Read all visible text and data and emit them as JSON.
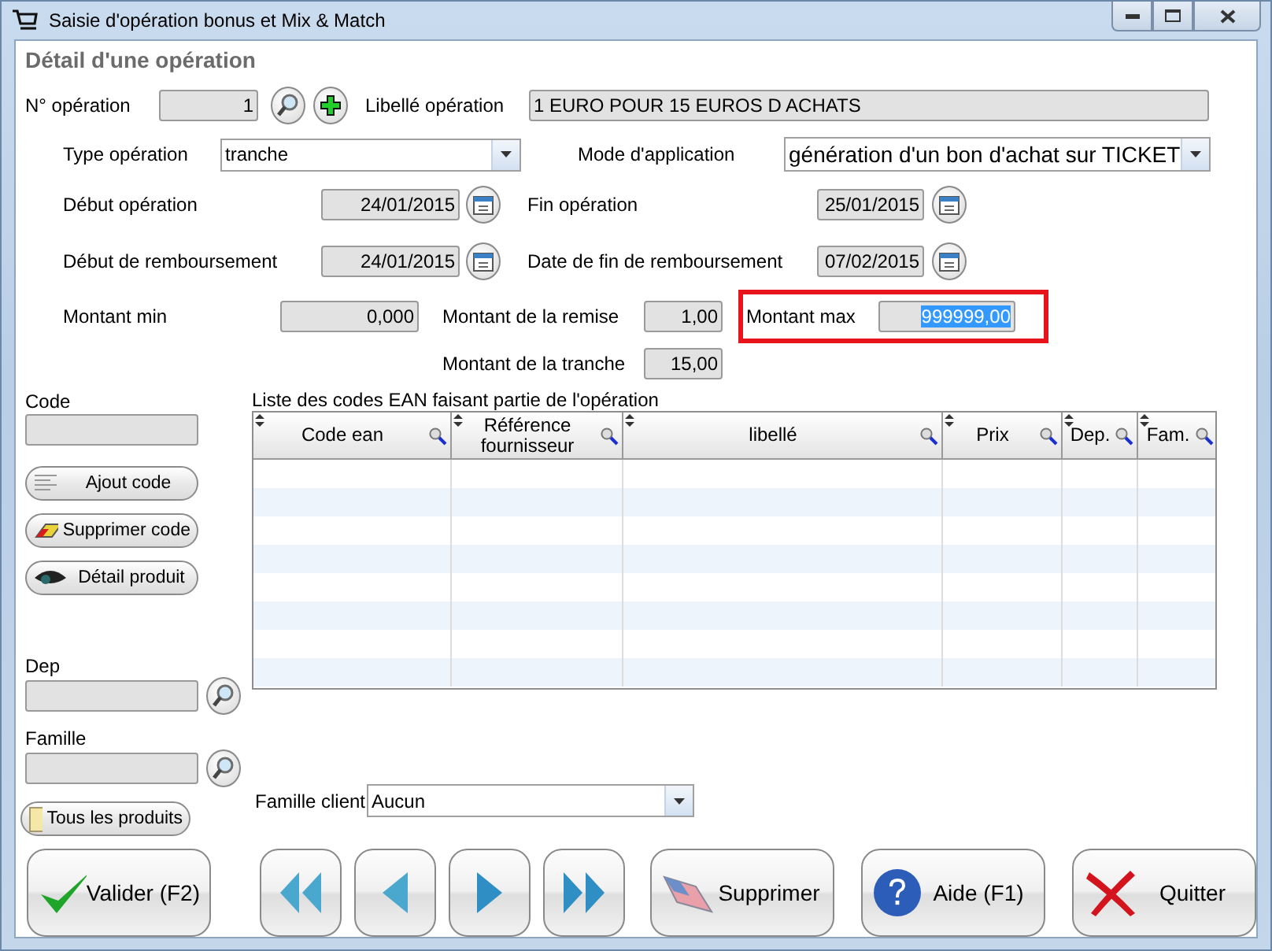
{
  "window": {
    "title": "Saisie d'opération bonus et Mix & Match"
  },
  "section_title": "Détail d'une opération",
  "operation_number": {
    "label": "N° opération",
    "value": "1"
  },
  "operation_label": {
    "label": "Libellé opération",
    "value": "1 EURO POUR 15 EUROS D ACHATS"
  },
  "operation_type": {
    "label": "Type opération",
    "value": "tranche"
  },
  "application_mode": {
    "label": "Mode d'application",
    "value": "génération d'un bon d'achat sur TICKET"
  },
  "dates": [
    {
      "label": "Début opération",
      "value": "24/01/2015"
    },
    {
      "label": "Fin opération",
      "value": "25/01/2015"
    },
    {
      "label": "Début de remboursement",
      "value": "24/01/2015"
    },
    {
      "label": "Date de fin de remboursement",
      "value": "07/02/2015"
    }
  ],
  "amount_min": {
    "label": "Montant min",
    "value": "0,000"
  },
  "discount_amount": {
    "label": "Montant de la remise",
    "value": "1,00"
  },
  "amount_max": {
    "label": "Montant max",
    "value": "999999,00",
    "highlighted": true,
    "text_selected": true
  },
  "bracket_amount": {
    "label": "Montant de la tranche",
    "value": "15,00"
  },
  "code": {
    "label": "Code"
  },
  "left_buttons": [
    {
      "kind": "list",
      "label": "Ajout code"
    },
    {
      "kind": "eraser",
      "label": "Supprimer code"
    },
    {
      "kind": "eye",
      "label": "Détail produit"
    }
  ],
  "dep": {
    "label": "Dep"
  },
  "family": {
    "label": "Famille"
  },
  "all_products_button": "Tous les produits",
  "table": {
    "caption": "Liste des codes EAN faisant partie de l'opération",
    "columns": [
      "Code ean",
      "Référence fournisseur",
      "libellé",
      "Prix",
      "Dep.",
      "Fam."
    ]
  },
  "client_family": {
    "label": "Famille client",
    "value": "Aucun"
  },
  "bottom_buttons": [
    {
      "kind": "validate",
      "label": "Valider (F2)"
    },
    {
      "kind": "first"
    },
    {
      "kind": "prev"
    },
    {
      "kind": "next"
    },
    {
      "kind": "last"
    },
    {
      "kind": "delete",
      "label": "Supprimer"
    },
    {
      "kind": "help",
      "label": "Aide (F1)"
    },
    {
      "kind": "quit",
      "label": "Quitter"
    }
  ]
}
